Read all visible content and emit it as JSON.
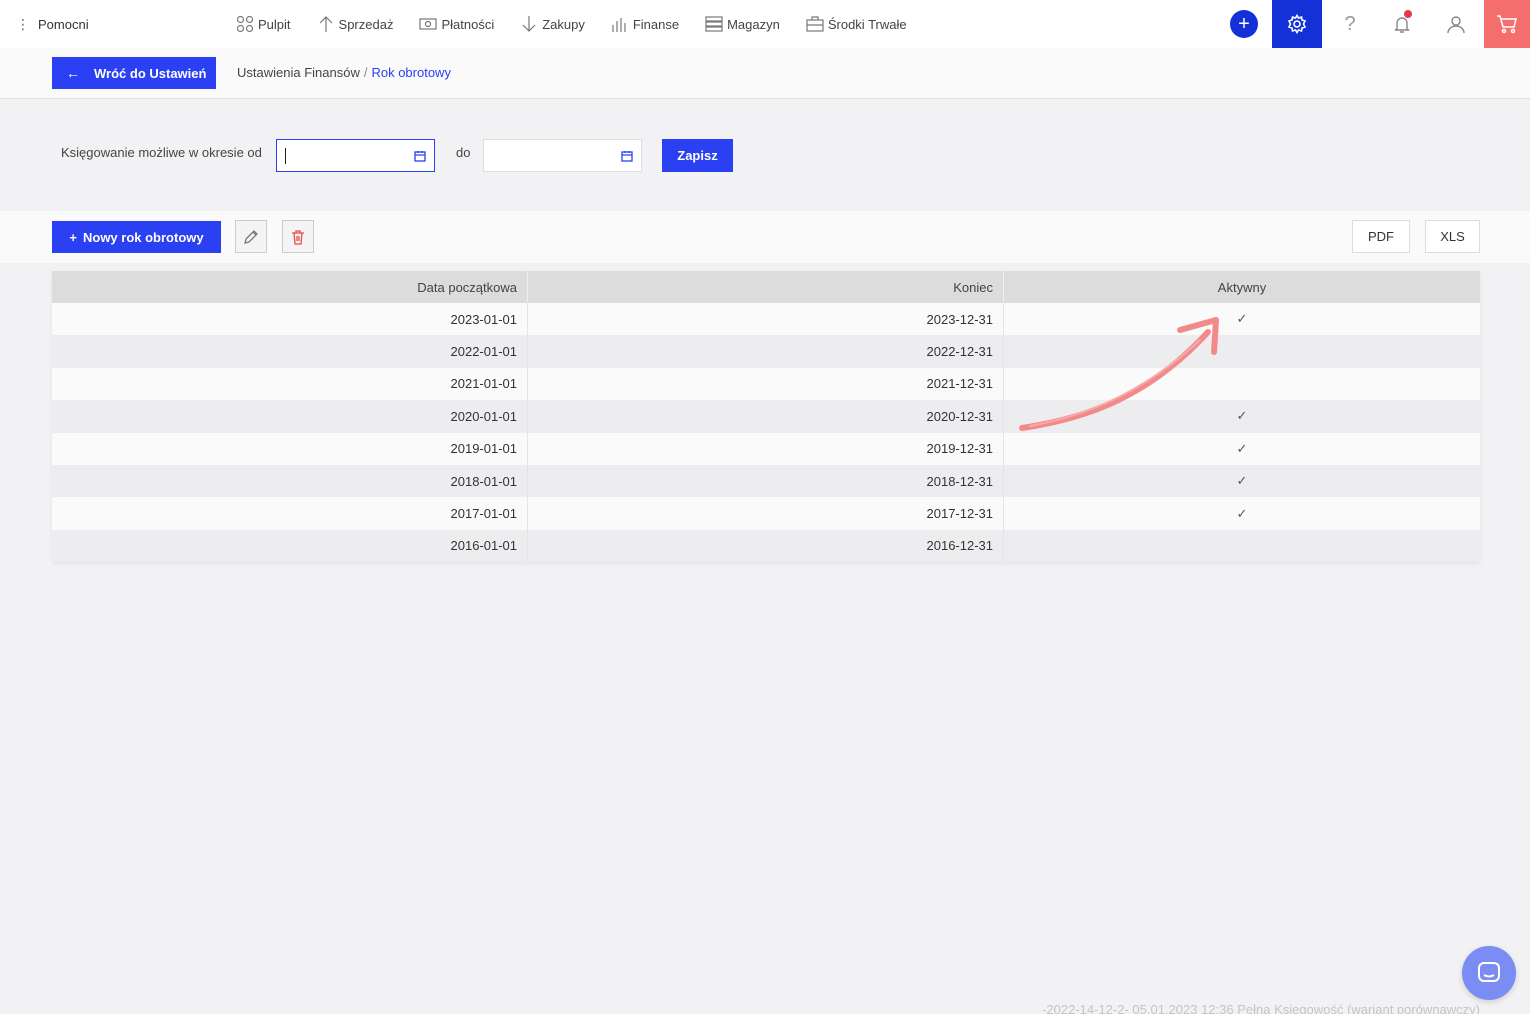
{
  "app": {
    "brand": "Pomocni"
  },
  "nav": {
    "items": [
      {
        "label": "Pulpit",
        "icon": "dashboard-icon"
      },
      {
        "label": "Sprzedaż",
        "icon": "arrow-up-icon"
      },
      {
        "label": "Płatności",
        "icon": "money-icon"
      },
      {
        "label": "Zakupy",
        "icon": "arrow-down-icon"
      },
      {
        "label": "Finanse",
        "icon": "bars-icon"
      },
      {
        "label": "Magazyn",
        "icon": "warehouse-icon"
      },
      {
        "label": "Środki Trwałe",
        "icon": "fixed-assets-icon"
      }
    ],
    "accent": "#1331d6",
    "cart_color": "#f56e6e"
  },
  "crumbs": {
    "back_label": "Wróć do Ustawień",
    "parent": "Ustawienia Finansów",
    "separator": "/",
    "current": "Rok obrotowy"
  },
  "period": {
    "label": "Księgowanie możliwe w okresie od",
    "from_value": "",
    "to_label": "do",
    "to_value": "",
    "save_label": "Zapisz"
  },
  "toolbar": {
    "new_label": "Nowy rok obrotowy",
    "pdf_label": "PDF",
    "xls_label": "XLS"
  },
  "table": {
    "columns": [
      "Data początkowa",
      "Koniec",
      "Aktywny"
    ],
    "rows": [
      {
        "start": "2023-01-01",
        "end": "2023-12-31",
        "active": "✓"
      },
      {
        "start": "2022-01-01",
        "end": "2022-12-31",
        "active": ""
      },
      {
        "start": "2021-01-01",
        "end": "2021-12-31",
        "active": ""
      },
      {
        "start": "2020-01-01",
        "end": "2020-12-31",
        "active": "✓"
      },
      {
        "start": "2019-01-01",
        "end": "2019-12-31",
        "active": "✓"
      },
      {
        "start": "2018-01-01",
        "end": "2018-12-31",
        "active": "✓"
      },
      {
        "start": "2017-01-01",
        "end": "2017-12-31",
        "active": "✓"
      },
      {
        "start": "2016-01-01",
        "end": "2016-12-31",
        "active": ""
      }
    ]
  },
  "footer": {
    "version_text": "-2022-14-12-2- 05.01.2023 12:36 Pełna Księgowość (wariant porównawczy)"
  },
  "colors": {
    "primary": "#2a40f2",
    "annotation_arrow": "#f28a8a"
  }
}
